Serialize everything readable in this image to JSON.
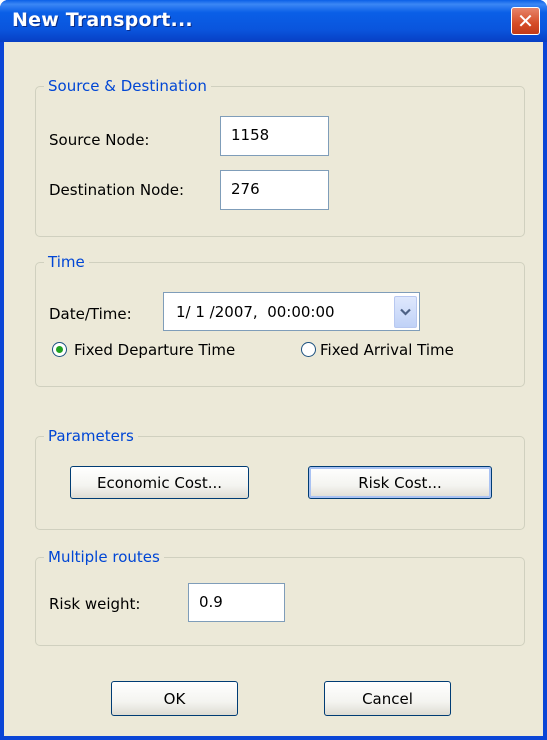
{
  "window": {
    "title": "New Transport...",
    "close_symbol": "✕"
  },
  "source_destination": {
    "legend": "Source & Destination",
    "source_label": "Source Node:",
    "source_value": "1158",
    "destination_label": "Destination Node:",
    "destination_value": "276"
  },
  "time": {
    "legend": "Time",
    "datetime_label": "Date/Time:",
    "datetime_value": "1/ 1 /2007,  00:00:00",
    "fixed_departure_label": "Fixed Departure Time",
    "fixed_departure_selected": true,
    "fixed_arrival_label": "Fixed Arrival Time",
    "fixed_arrival_selected": false
  },
  "parameters": {
    "legend": "Parameters",
    "economic_cost_label": "Economic Cost...",
    "risk_cost_label": "Risk Cost..."
  },
  "multiple_routes": {
    "legend": "Multiple routes",
    "risk_weight_label": "Risk weight:",
    "risk_weight_value": "0.9"
  },
  "footer": {
    "ok_label": "OK",
    "cancel_label": "Cancel"
  },
  "colors": {
    "title_bar": "#0a55dd",
    "dialog_background": "#ece9d8",
    "group_legend": "#0046d5",
    "radio_selected": "#21a121"
  },
  "icons": {
    "close": "close-icon",
    "dropdown": "chevron-down-icon"
  }
}
